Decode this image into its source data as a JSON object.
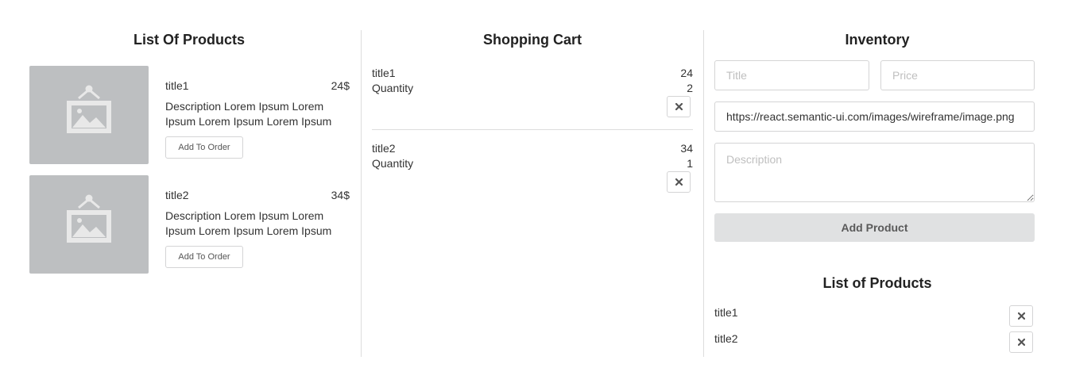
{
  "products_panel": {
    "title": "List Of Products",
    "add_label": "Add To Order",
    "items": [
      {
        "name": "title1",
        "price": "24$",
        "description": "Description Lorem Ipsum Lorem Ipsum Lorem Ipsum Lorem Ipsum"
      },
      {
        "name": "title2",
        "price": "34$",
        "description": "Description Lorem Ipsum Lorem Ipsum Lorem Ipsum Lorem Ipsum"
      }
    ]
  },
  "cart_panel": {
    "title": "Shopping Cart",
    "quantity_label": "Quantity",
    "items": [
      {
        "name": "title1",
        "price": "24",
        "quantity": "2"
      },
      {
        "name": "title2",
        "price": "34",
        "quantity": "1"
      }
    ]
  },
  "inventory_panel": {
    "title": "Inventory",
    "title_placeholder": "Title",
    "price_placeholder": "Price",
    "image_url_value": "https://react.semantic-ui.com/images/wireframe/image.png",
    "description_placeholder": "Description",
    "add_product_label": "Add Product",
    "list_title": "List of Products",
    "list_items": [
      {
        "name": "title1"
      },
      {
        "name": "title2"
      }
    ]
  },
  "icons": {
    "image_placeholder": "image-placeholder-icon",
    "remove": "close-icon"
  },
  "colors": {
    "placeholder_image_bg": "#bdbfc1",
    "button_grey": "#e0e1e2",
    "border": "#d4d4d5"
  }
}
